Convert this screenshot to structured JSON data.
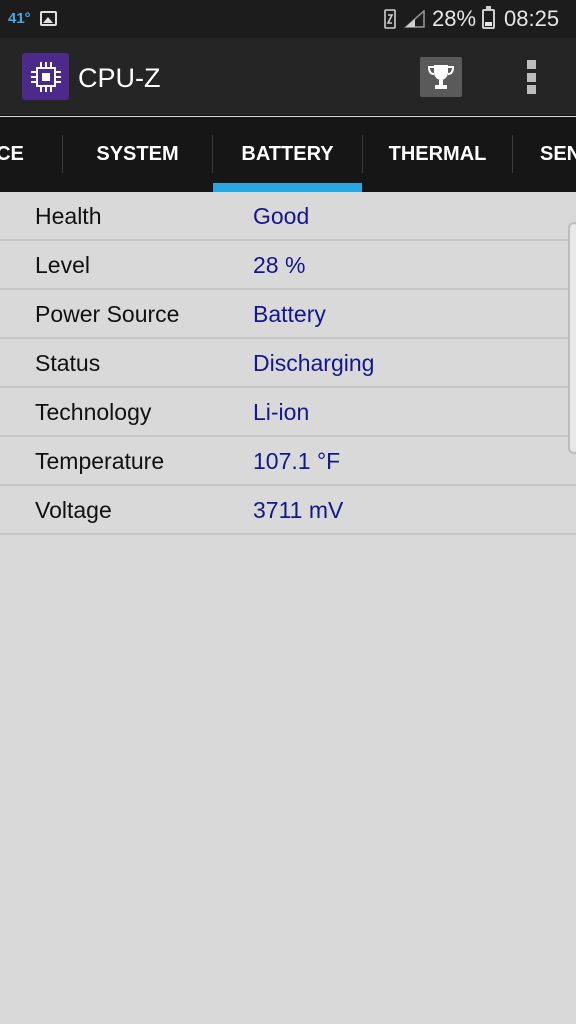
{
  "status_bar": {
    "temperature": "41°",
    "battery_percent": "28%",
    "battery_level": 0.28,
    "time": "08:25",
    "icons": [
      "gallery-icon",
      "nfc-icon",
      "signal-icon",
      "battery-icon"
    ]
  },
  "app_bar": {
    "title": "CPU-Z",
    "icons": [
      "cpu-logo-icon",
      "trophy-icon",
      "overflow-menu-icon"
    ]
  },
  "tabs": [
    {
      "label": "CE"
    },
    {
      "label": "SYSTEM"
    },
    {
      "label": "BATTERY"
    },
    {
      "label": "THERMAL"
    },
    {
      "label": "SEN"
    }
  ],
  "active_tab": "BATTERY",
  "battery": {
    "rows": [
      {
        "label": "Health",
        "value": "Good"
      },
      {
        "label": "Level",
        "value": "28 %"
      },
      {
        "label": "Power Source",
        "value": "Battery"
      },
      {
        "label": "Status",
        "value": "Discharging"
      },
      {
        "label": "Technology",
        "value": "Li-ion"
      },
      {
        "label": "Temperature",
        "value": "107.1 °F"
      },
      {
        "label": "Voltage",
        "value": "3711 mV"
      }
    ]
  },
  "colors": {
    "accent": "#2ba7df",
    "value_text": "#16168c",
    "logo_bg": "#4b2a8c"
  }
}
